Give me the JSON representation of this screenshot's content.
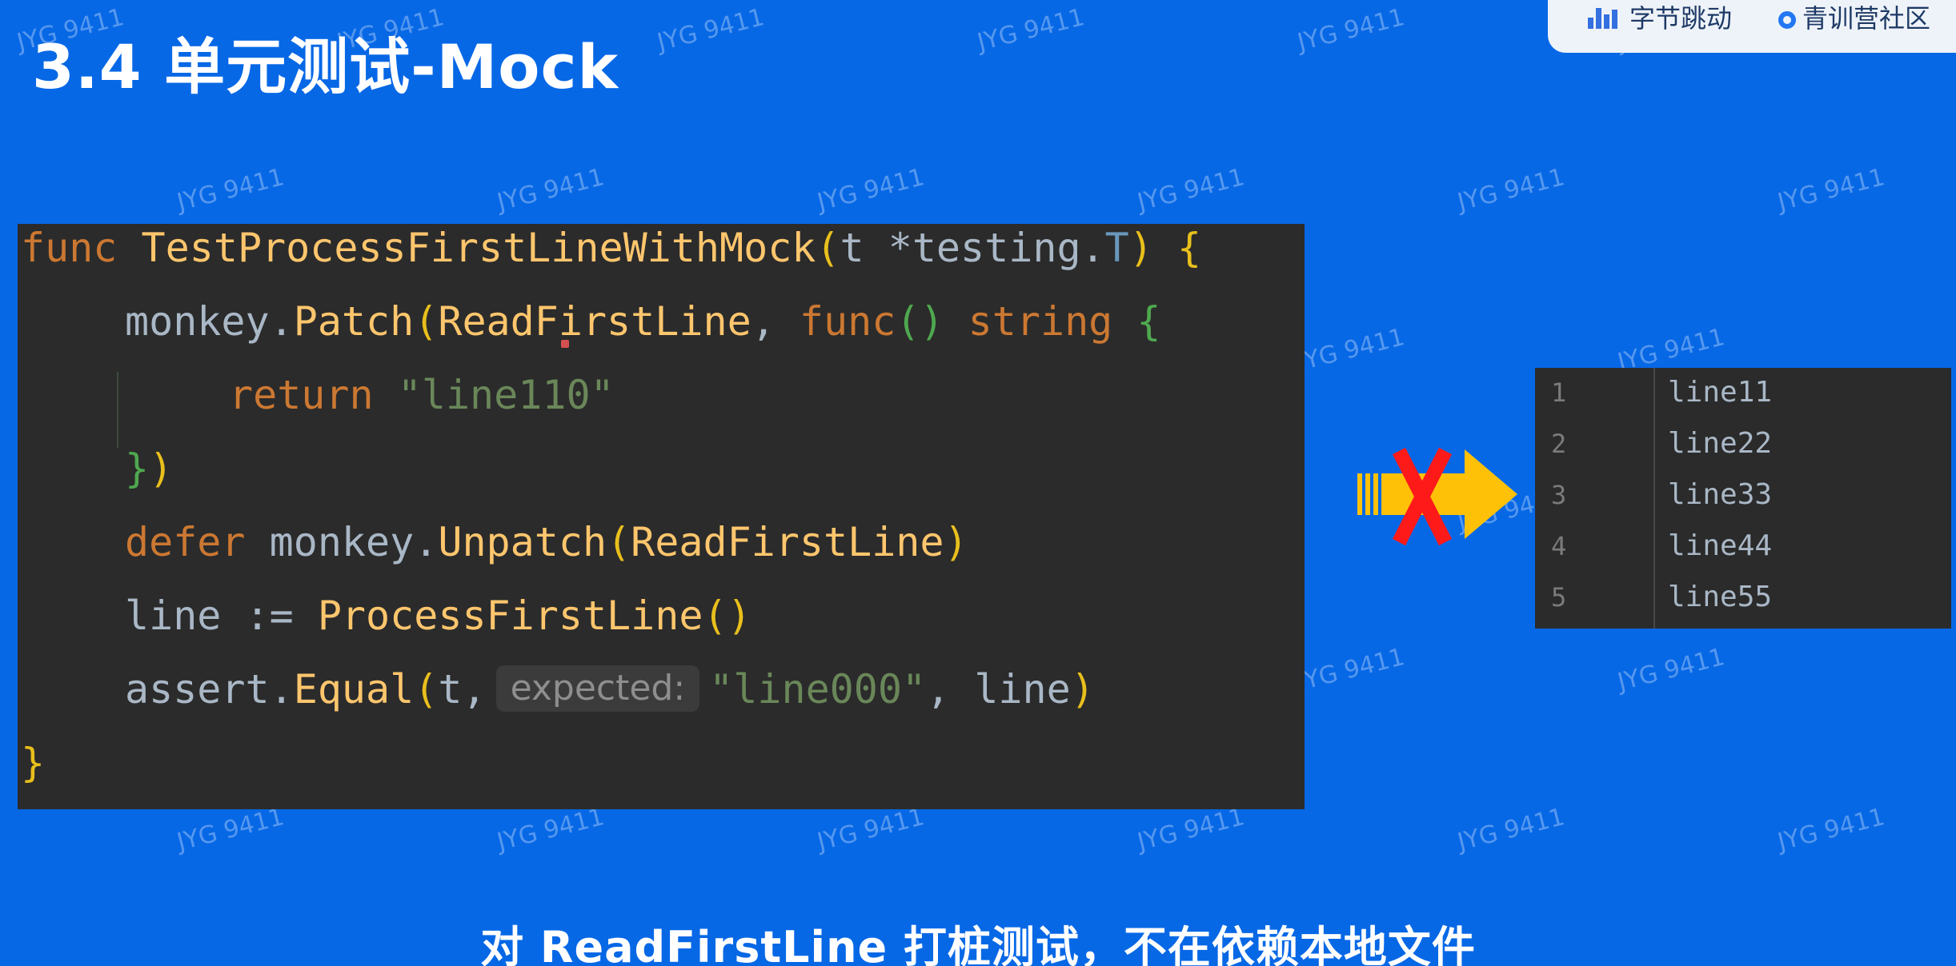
{
  "slide": {
    "title": "3.4 单元测试-Mock",
    "caption": "对 ReadFirstLine 打桩测试，不在依赖本地文件"
  },
  "brand": {
    "logo1_text": "字节跳动",
    "logo2_text": "青训营社区"
  },
  "code": {
    "l1": {
      "kw": "func",
      "fn": "TestProcessFirstLineWithMock",
      "p_open": "(",
      "param": "t *testing.",
      "ptype": "T",
      "p_close": ")",
      "brace": "{"
    },
    "l2": {
      "recv": "monkey.",
      "fn": "Patch",
      "p_open": "(",
      "arg1": "ReadFirstLine",
      "comma": ", ",
      "kw": "func",
      "paren": "()",
      "ret": "string",
      "brace": "{"
    },
    "l3": {
      "kw": "return",
      "str": "\"line110\""
    },
    "l4": {
      "brace": "}",
      "paren": ")"
    },
    "l5": {
      "kw": "defer",
      "recv": "monkey.",
      "fn": "Unpatch",
      "p_open": "(",
      "arg": "ReadFirstLine",
      "p_close": ")"
    },
    "l6": {
      "var": "line :=",
      "fn": "ProcessFirstLine",
      "paren": "()"
    },
    "l7": {
      "recv": "assert.",
      "fn": "Equal",
      "p_open": "(",
      "arg1": "t,",
      "hint": "expected:",
      "str": "\"line000\"",
      "rest": ", line",
      "p_close": ")"
    },
    "l8": {
      "brace": "}"
    }
  },
  "file": {
    "lines": [
      {
        "num": "1",
        "text": "line11"
      },
      {
        "num": "2",
        "text": "line22"
      },
      {
        "num": "3",
        "text": "line33"
      },
      {
        "num": "4",
        "text": "line44"
      },
      {
        "num": "5",
        "text": "line55"
      }
    ]
  },
  "icons": {
    "arrow": "blocked-arrow-icon",
    "cross_color": "#ff1a1a",
    "arrow_color": "#ffc107"
  },
  "watermark": {
    "text": "JYG 9411"
  },
  "colors": {
    "background": "#0768e6",
    "code_bg": "#2b2b2b"
  }
}
